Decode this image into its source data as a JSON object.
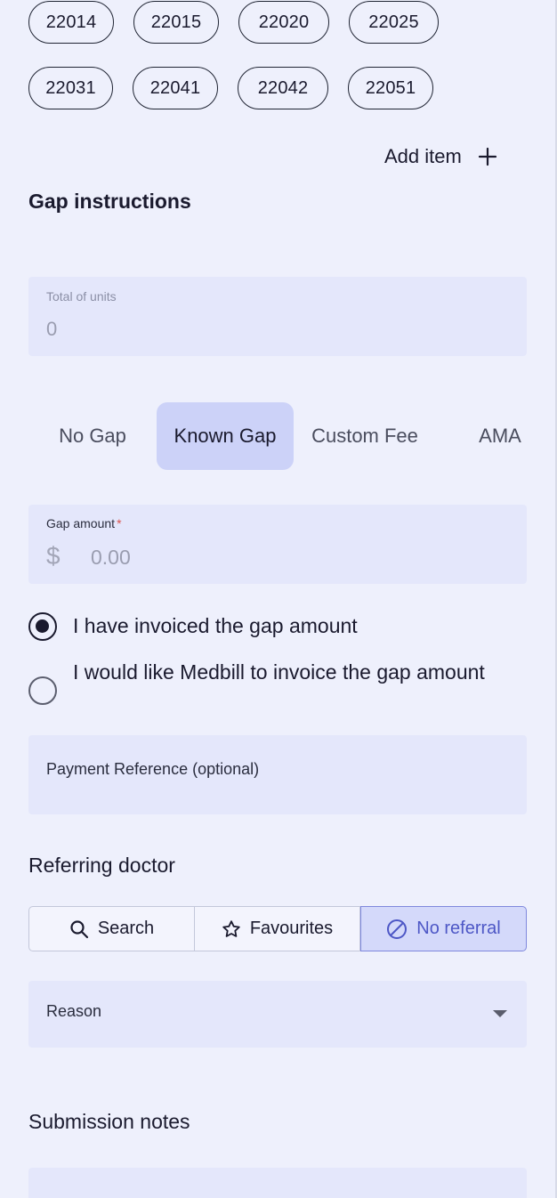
{
  "item_codes": [
    "22014",
    "22015",
    "22020",
    "22025",
    "22031",
    "22041",
    "22042",
    "22051"
  ],
  "add_item": {
    "label": "Add item"
  },
  "gap_instructions": {
    "title": "Gap instructions",
    "total_units": {
      "label": "Total of units",
      "value": "0"
    },
    "tabs": [
      {
        "label": "No Gap",
        "active": false
      },
      {
        "label": "Known Gap",
        "active": true
      },
      {
        "label": "Custom Fee",
        "active": false
      },
      {
        "label": "AMA",
        "active": false
      }
    ],
    "gap_amount": {
      "label": "Gap amount",
      "required_mark": "*",
      "currency": "$",
      "placeholder": "0.00"
    },
    "invoice_options": [
      {
        "label": "I have invoiced the gap amount",
        "selected": true
      },
      {
        "label": "I would like Medbill to invoice the gap amount",
        "selected": false
      }
    ],
    "payment_reference": {
      "placeholder": "Payment Reference (optional)"
    }
  },
  "referring_doctor": {
    "title": "Referring doctor",
    "segments": [
      {
        "label": "Search",
        "icon": "search-icon",
        "active": false
      },
      {
        "label": "Favourites",
        "icon": "star-icon",
        "active": false
      },
      {
        "label": "No referral",
        "icon": "no-entry-icon",
        "active": true
      }
    ],
    "reason": {
      "placeholder": "Reason"
    }
  },
  "submission_notes": {
    "title": "Submission notes"
  },
  "colors": {
    "background": "#eef0fc",
    "field": "#e4e7fb",
    "active_tab": "#ccd2f8",
    "accent": "#4d57c6",
    "required": "#d9534f"
  }
}
